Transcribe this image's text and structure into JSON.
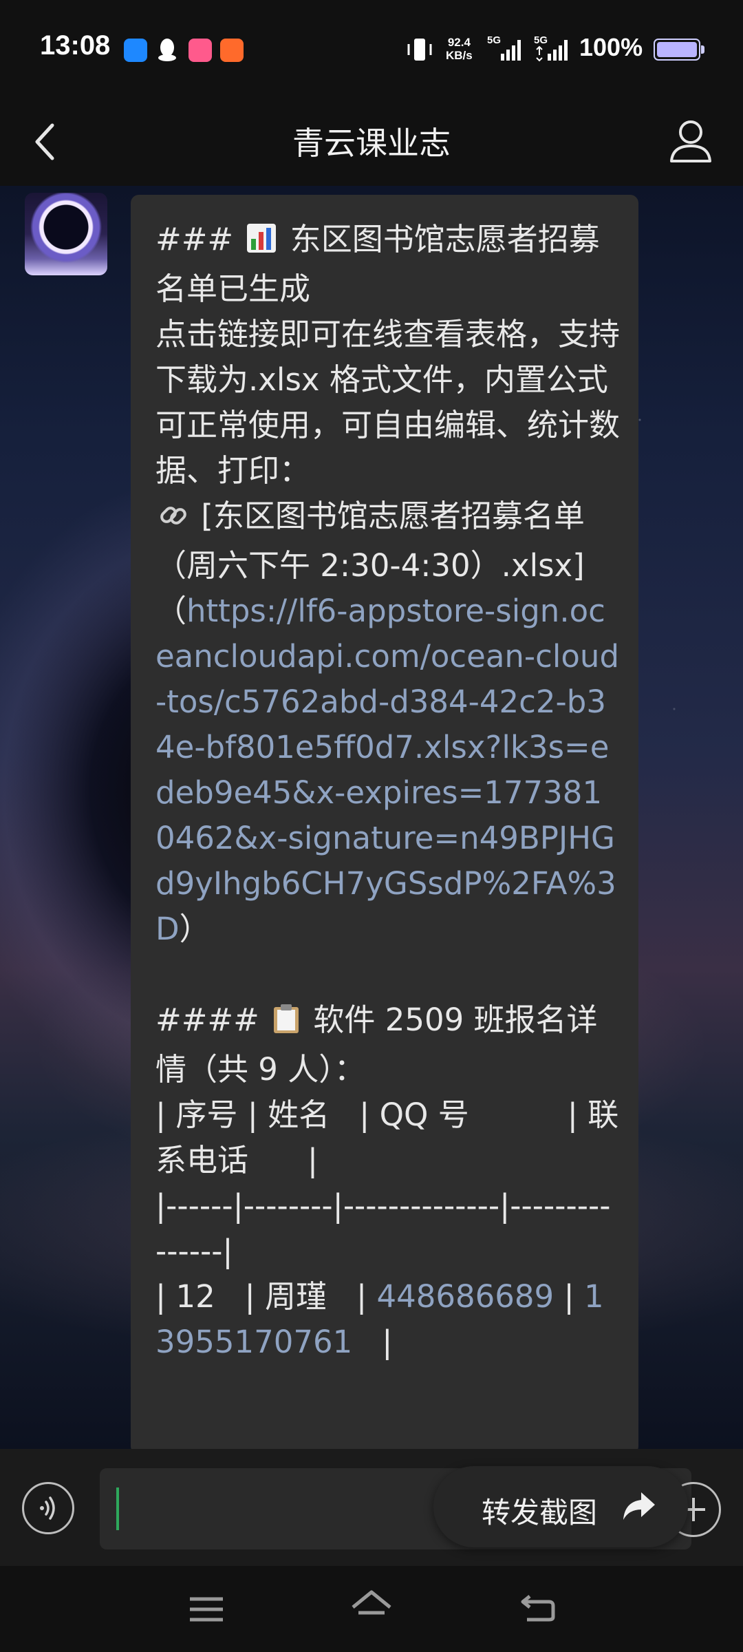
{
  "status_bar": {
    "time": "13:08",
    "net_speed_value": "92.4",
    "net_speed_unit": "KB/s",
    "signal1_label": "5G",
    "signal2_label": "5G",
    "battery": "100%"
  },
  "header": {
    "title": "青云课业志"
  },
  "message": {
    "line_heading_prefix": "### ",
    "heading_text": " 东区图书馆志愿者招募名单已生成",
    "intro": "点击链接即可在线查看表格，支持下载为.xlsx 格式文件，内置公式可正常使用，可自由编辑、统计数据、打印：",
    "file_label": " [东区图书馆志愿者招募名单（周六下午 2:30-4:30）.xlsx]（",
    "link_url": "https://lf6-appstore-sign.oceancloudapi.com/ocean-cloud-tos/c5762abd-d384-42c2-b34e-bf801e5ff0d7.xlsx?lk3s=edeb9e45&x-expires=1773810462&x-signature=n49BPJHGd9yIhgb6CH7yGSsdP%2FA%3D",
    "link_close": "）",
    "section_prefix": "#### ",
    "section_text": " 软件 2509 班报名详情（共 9 人）：",
    "table_header": "| 序号 | 姓名   | QQ 号          | 联系电话      |",
    "table_divider": "|------|--------|--------------|---------------|",
    "row1_prefix": "| 12   | 周瑾   | ",
    "row1_qq": "448686689",
    "row1_mid": " | ",
    "row1_phone": "13955170761",
    "row1_end": "   |"
  },
  "forward_button": {
    "label": "转发截图"
  },
  "colors": {
    "bubble": "#2e2e2e",
    "link": "#8fa3c2",
    "caret": "#2ea85c"
  },
  "icons": [
    "back-arrow-icon",
    "profile-icon",
    "bar-chart-icon",
    "link-icon",
    "clipboard-icon",
    "voice-icon",
    "plus-icon",
    "share-arrow-icon",
    "menu-icon",
    "home-icon",
    "return-icon"
  ]
}
